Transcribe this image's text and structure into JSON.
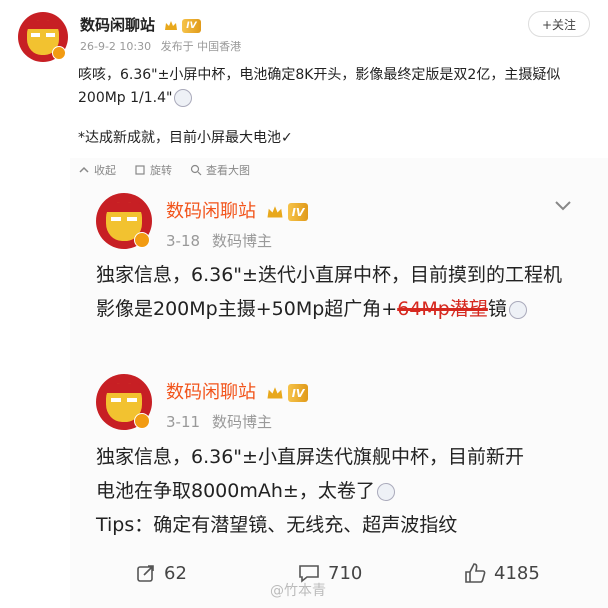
{
  "top_post": {
    "author": "数码闲聊站",
    "vip_level": "IV",
    "timestamp": "26-9-2 10:30",
    "source": "发布于 中国香港",
    "follow_label": "+关注",
    "paragraph1": "咳咳，6.36\"±小屏中杯，电池确定8K开头，影像最终定版是双2亿，主摄疑似200Mp 1/1.4\"",
    "paragraph2": "*达成新成就，目前小屏最大电池✓",
    "actions": {
      "collapse": "收起",
      "rotate": "旋转",
      "zoom": "查看大图"
    }
  },
  "quoted_posts": [
    {
      "author": "数码闲聊站",
      "vip_level": "IV",
      "date": "3-18",
      "role": "数码博主",
      "text_before": "独家信息，6.36\"±迭代小直屏中杯，目前摸到的工程机影像是200Mp主摄+50Mp超广角+",
      "text_struck": "64Mp潜望",
      "text_after": "镜"
    },
    {
      "author": "数码闲聊站",
      "vip_level": "IV",
      "date": "3-11",
      "role": "数码博主",
      "line1": "独家信息，6.36\"±小直屏迭代旗舰中杯，目前新开",
      "line2": "电池在争取8000mAh±，太卷了",
      "line3": "Tips：确定有潜望镜、无线充、超声波指纹"
    }
  ],
  "bottom_bar": {
    "reposts": "62",
    "comments": "710",
    "likes": "4185"
  },
  "watermark": "@竹本青",
  "colors": {
    "accent": "#f2541b",
    "vip_gold": "#e09a1a",
    "strike_red": "#d6281f"
  }
}
